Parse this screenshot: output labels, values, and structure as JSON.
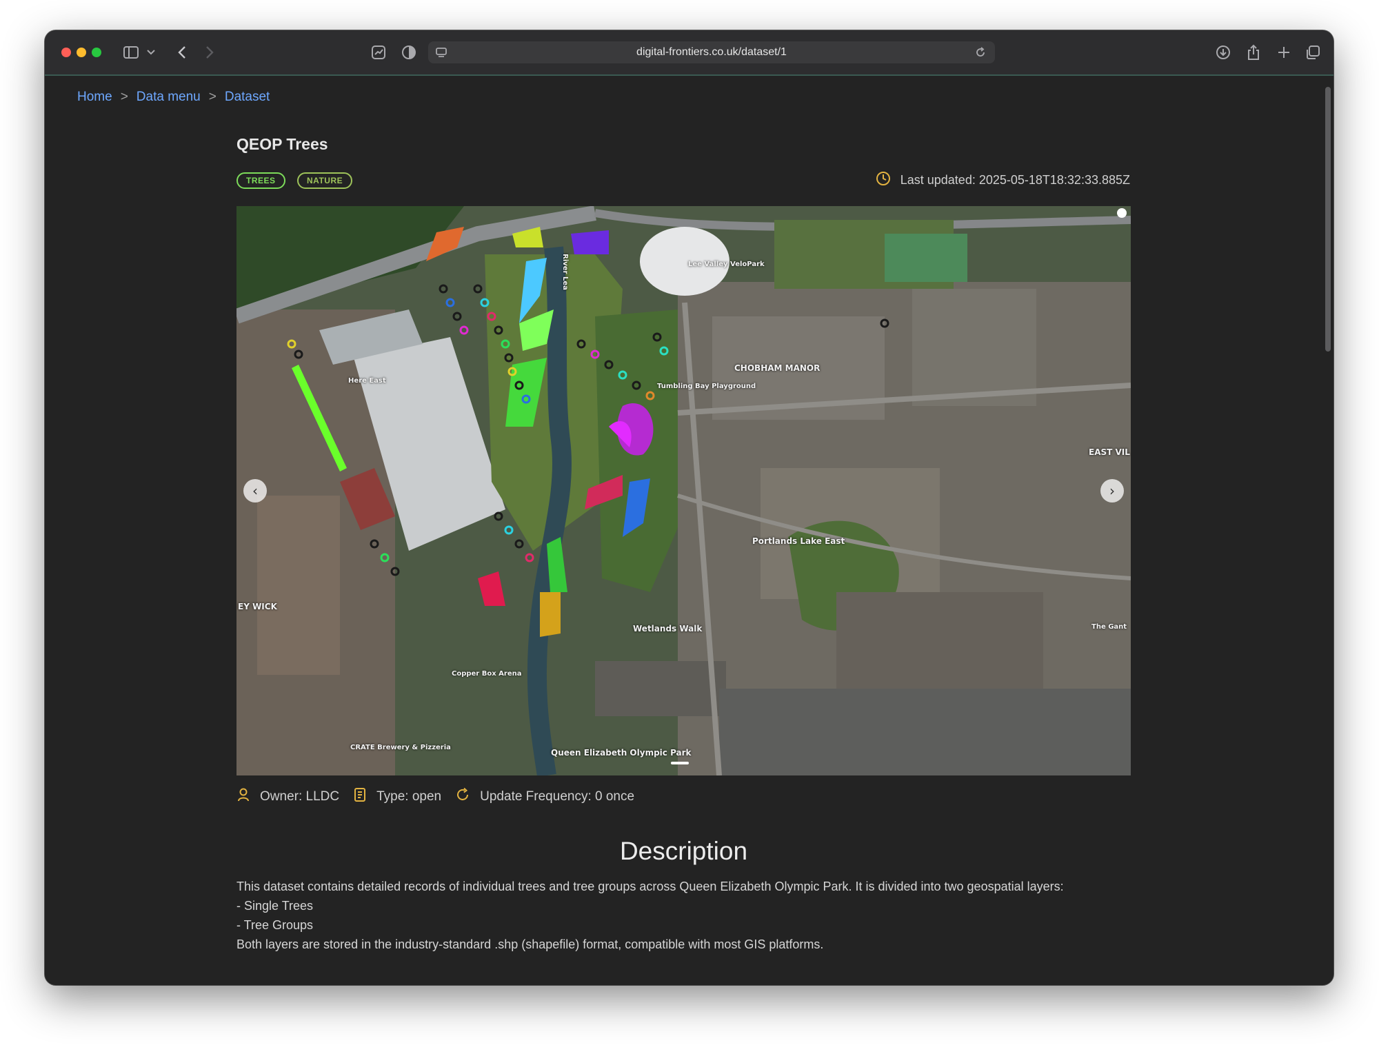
{
  "browser": {
    "url": "digital-frontiers.co.uk/dataset/1"
  },
  "breadcrumb": {
    "items": [
      "Home",
      "Data menu",
      "Dataset"
    ],
    "separator": ">"
  },
  "dataset": {
    "title": "QEOP Trees",
    "tags": [
      {
        "label": "TREES",
        "color": "#7ddc5a"
      },
      {
        "label": "NATURE",
        "color": "#9ec35a"
      }
    ],
    "last_updated": "Last updated: 2025-05-18T18:32:33.885Z",
    "owner": "Owner: LLDC",
    "type": "Type: open",
    "update_frequency": "Update Frequency: 0 once"
  },
  "map": {
    "labels": [
      "Lee Valley VeloPark",
      "River Lea",
      "Here East",
      "CHOBHAM MANOR",
      "Tumbling Bay Playground",
      "EAST VIL",
      "Portlands Lake East",
      "EY WICK",
      "Wetlands Walk",
      "The Gant",
      "Copper Box Arena",
      "Queen Elizabeth Olympic Park",
      "CRATE Brewery & Pizzeria"
    ]
  },
  "description": {
    "heading": "Description",
    "lines": [
      "This dataset contains detailed records of individual trees and tree groups across Queen Elizabeth Olympic Park. It is divided into two geospatial layers:",
      "- Single Trees",
      "- Tree Groups",
      "Both layers are stored in the industry-standard .shp (shapefile) format, compatible with most GIS platforms."
    ]
  },
  "colors": {
    "link": "#6ea8ff",
    "accent_icon": "#e3b341",
    "background": "#232323"
  }
}
